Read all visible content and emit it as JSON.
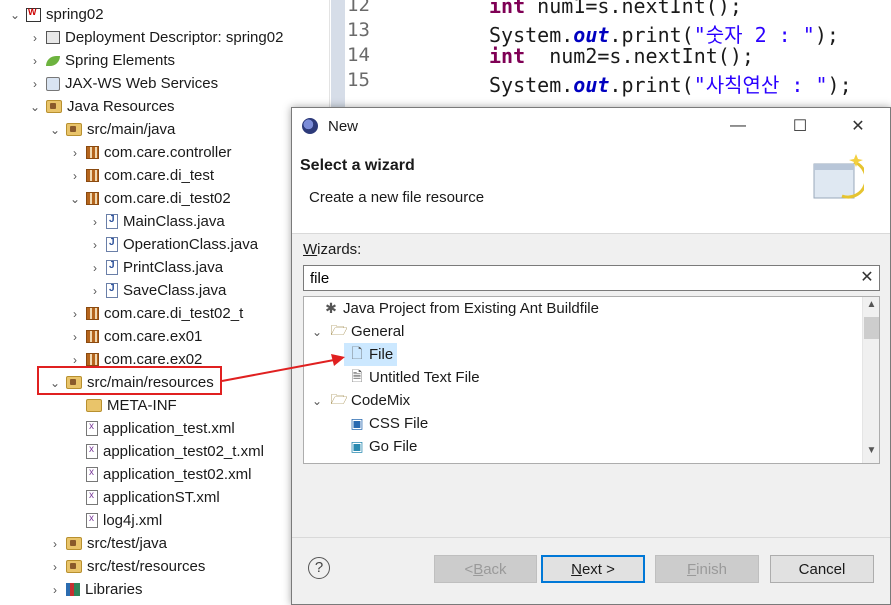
{
  "explorer": {
    "rows": [
      {
        "label": "spring02",
        "toggle": "⌄",
        "icon": "web-project-icon"
      },
      {
        "label": "Deployment Descriptor: spring02",
        "toggle": "›",
        "icon": "deployment-descriptor-icon"
      },
      {
        "label": "Spring Elements",
        "toggle": "›",
        "icon": "spring-leaf-icon"
      },
      {
        "label": "JAX-WS Web Services",
        "toggle": "›",
        "icon": "web-services-icon"
      },
      {
        "label": "Java Resources",
        "toggle": "⌄",
        "icon": "java-resources-icon"
      },
      {
        "label": "src/main/java",
        "toggle": "⌄",
        "icon": "source-folder-icon"
      },
      {
        "label": "com.care.controller",
        "toggle": "›",
        "icon": "package-icon"
      },
      {
        "label": "com.care.di_test",
        "toggle": "›",
        "icon": "package-icon"
      },
      {
        "label": "com.care.di_test02",
        "toggle": "⌄",
        "icon": "package-icon"
      },
      {
        "label": "MainClass.java",
        "toggle": "›",
        "icon": "java-file-icon"
      },
      {
        "label": "OperationClass.java",
        "toggle": "›",
        "icon": "java-file-icon"
      },
      {
        "label": "PrintClass.java",
        "toggle": "›",
        "icon": "java-file-icon"
      },
      {
        "label": "SaveClass.java",
        "toggle": "›",
        "icon": "java-file-icon"
      },
      {
        "label": "com.care.di_test02_t",
        "toggle": "›",
        "icon": "package-icon"
      },
      {
        "label": "com.care.ex01",
        "toggle": "›",
        "icon": "package-icon"
      },
      {
        "label": "com.care.ex02",
        "toggle": "›",
        "icon": "package-icon"
      },
      {
        "label": "src/main/resources",
        "toggle": "⌄",
        "icon": "source-folder-icon"
      },
      {
        "label": "META-INF",
        "toggle": "",
        "icon": "folder-icon"
      },
      {
        "label": "application_test.xml",
        "toggle": "",
        "icon": "xml-file-icon"
      },
      {
        "label": "application_test02_t.xml",
        "toggle": "",
        "icon": "xml-file-icon"
      },
      {
        "label": "application_test02.xml",
        "toggle": "",
        "icon": "xml-file-icon"
      },
      {
        "label": "applicationST.xml",
        "toggle": "",
        "icon": "xml-file-icon"
      },
      {
        "label": "log4j.xml",
        "toggle": "",
        "icon": "xml-file-icon"
      },
      {
        "label": "src/test/java",
        "toggle": "›",
        "icon": "source-folder-icon"
      },
      {
        "label": "src/test/resources",
        "toggle": "›",
        "icon": "source-folder-icon"
      },
      {
        "label": "Libraries",
        "toggle": "›",
        "icon": "libraries-icon"
      }
    ]
  },
  "editor": {
    "lines": [
      {
        "num": "12",
        "parts": [
          [
            "kw",
            "int"
          ],
          [
            "",
            "num1=s.nextInt();"
          ]
        ]
      },
      {
        "num": "13",
        "parts": [
          [
            "",
            "System."
          ],
          [
            "fld",
            "out"
          ],
          [
            "",
            ".print("
          ],
          [
            "str",
            "\"숫자 2 : \""
          ],
          [
            "",
            ");"
          ]
        ]
      },
      {
        "num": "14",
        "parts": [
          [
            "kw",
            "int"
          ],
          [
            "",
            " num2=s.nextInt();"
          ]
        ]
      },
      {
        "num": "15",
        "parts": [
          [
            "",
            "System."
          ],
          [
            "fld",
            "out"
          ],
          [
            "",
            ".print("
          ],
          [
            "str",
            "\"사칙연산 : \""
          ],
          [
            "",
            ");"
          ]
        ]
      }
    ]
  },
  "dialog": {
    "title": "New",
    "minimize": "—",
    "maximize": "☐",
    "close": "✕",
    "header_title": "Select a wizard",
    "header_desc": "Create a new file resource",
    "wizards_label_mnemonic": "W",
    "wizards_label_rest": "izards:",
    "filter_value": "file",
    "filter_clear": "✕",
    "items": [
      {
        "label": "Java Project from Existing Ant Buildfile",
        "toggle": "",
        "icon": "ant-icon",
        "selected": false
      },
      {
        "label": "General",
        "toggle": "⌄",
        "icon": "folder-icon",
        "selected": false
      },
      {
        "label": "File",
        "toggle": "",
        "icon": "new-file-icon",
        "selected": true
      },
      {
        "label": "Untitled Text File",
        "toggle": "",
        "icon": "text-file-icon",
        "selected": false
      },
      {
        "label": "CodeMix",
        "toggle": "⌄",
        "icon": "folder-icon",
        "selected": false
      },
      {
        "label": "CSS File",
        "toggle": "",
        "icon": "css-file-icon",
        "selected": false
      },
      {
        "label": "Go File",
        "toggle": "",
        "icon": "go-file-icon",
        "selected": false
      }
    ],
    "help": "?",
    "back_mn": "B",
    "back_pre": "< ",
    "back_rest": "ack",
    "next_mn": "N",
    "next_rest": "ext >",
    "finish_mn": "F",
    "finish_rest": "inish",
    "cancel": "Cancel"
  }
}
